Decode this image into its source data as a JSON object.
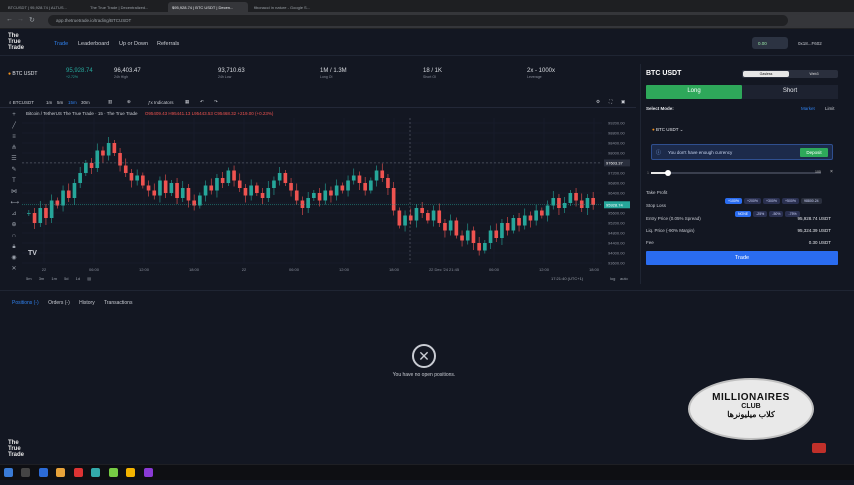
{
  "browser": {
    "tabs": [
      "BTCUSDT | 95,928.74 | ALTUS...",
      "The True Trade | Decentralized...",
      "$95,928.74 | BTC USDT | Decen...",
      "fibonacci in nature - Google S..."
    ],
    "url": "app.thetruetrade.io/trading/BTCUSDT"
  },
  "app": {
    "logo_line1": "The",
    "logo_line2": "True",
    "logo_line3": "Trade",
    "nav": [
      "Trade",
      "Leaderboard",
      "Up or Down",
      "Referrals"
    ],
    "balance": "0.00",
    "account": "0x18...F602"
  },
  "ticker": {
    "pair": "BTC USDT",
    "price": "95,928.74",
    "change": "+2.72%",
    "high_val": "96,403.47",
    "high_lbl": "24h High",
    "low_val": "93,710.63",
    "low_lbl": "24h Low",
    "long_oi_val": "1M / 1.3M",
    "long_oi_lbl": "Long OI",
    "short_oi_val": "18 / 1K",
    "short_oi_lbl": "Short OI",
    "lev_val": "2x - 1000x",
    "lev_lbl": "Leverage"
  },
  "toolbar": {
    "symbol": "BTCUSDT",
    "intervals": [
      "1m",
      "5m",
      "15m",
      "30m"
    ],
    "indicators": "Indicators"
  },
  "chart_data": {
    "type": "candlestick",
    "title": "Bitcoin / TetherUS  The True Trade · 15 · The True Trade",
    "ohlc_label": "O95409.43 H95441.13 L95443.53 C95468.32 +219.00 (+0.23%)",
    "ylim": [
      93600,
      99400
    ],
    "y_ticks": [
      "99200.00",
      "98800.00",
      "98400.00",
      "98000.00",
      "97600.00",
      "97200.00",
      "96800.00",
      "96400.00",
      "96000.00",
      "95600.00",
      "95200.00",
      "94800.00",
      "94400.00",
      "94000.00",
      "93600.00"
    ],
    "x_ticks": [
      "22",
      "06:00",
      "12:00",
      "18:00",
      "22",
      "06:00",
      "12:00",
      "18:00",
      "22 Dec '24  21:45",
      "06:00",
      "12:00",
      "18:00"
    ],
    "last_price_label": "95928.74",
    "crosshair_price_label": "97603.37",
    "close_series": [
      95600,
      95200,
      95800,
      95400,
      96100,
      95900,
      96500,
      96200,
      96800,
      97200,
      97600,
      97400,
      98100,
      97900,
      98400,
      98000,
      97500,
      97200,
      96900,
      97100,
      96700,
      96500,
      96300,
      96900,
      96400,
      96800,
      96200,
      96600,
      96100,
      95900,
      96300,
      96700,
      96500,
      97000,
      96800,
      97300,
      96900,
      96600,
      96300,
      96700,
      96400,
      96200,
      96600,
      96900,
      97200,
      96800,
      96500,
      96100,
      95800,
      96200,
      96400,
      96100,
      96500,
      96300,
      96700,
      96500,
      96900,
      97100,
      96800,
      96500,
      96900,
      97300,
      97000,
      96600,
      95700,
      95100,
      95500,
      95300,
      95800,
      95600,
      95300,
      95700,
      95200,
      94900,
      95300,
      94700,
      94500,
      94900,
      94400,
      94100,
      94400,
      94900,
      94600,
      95200,
      94900,
      95400,
      95100,
      95500,
      95300,
      95700,
      95500,
      95900,
      96200,
      95800,
      96000,
      96400,
      96100,
      95800,
      96200,
      95928
    ],
    "timezone": "17:21:40 (UTC+1)",
    "log_lbl": "log",
    "auto_lbl": "auto",
    "ranges": [
      "5m",
      "3m",
      "1m",
      "5d",
      "1d"
    ]
  },
  "panel": {
    "title": "BTC USDT",
    "toggle_a": "Gasless",
    "toggle_b": "Web3",
    "long": "Long",
    "short": "Short",
    "select_mode": "Select Mode:",
    "mode_market": "Market",
    "mode_limit": "Limit",
    "asset": "BTC USDT",
    "warning": "You don't have enough currency",
    "deposit": "Deposit",
    "slider_min": "1",
    "slider_max": "100",
    "tp_label": "Take Profit",
    "tp_chips": [
      "+100%",
      "+200%",
      "+300%",
      "+500%"
    ],
    "tp_val": "98800.24",
    "sl_label": "Stop Loss",
    "sl_chips": [
      "NONE",
      "-25%",
      "-50%",
      "-75%"
    ],
    "entry_label": "Entry Price (0.05% Spread)",
    "entry_val": "95,928.74 USDT",
    "liq_label": "Liq. Price (-90% Margin)",
    "liq_val": "95,324.39 USDT",
    "fee_label": "Fee",
    "fee_val": "0.30 USDT",
    "trade": "Trade"
  },
  "positions": {
    "tabs": [
      "Positions (-)",
      "Orders (-)",
      "History",
      "Transactions"
    ],
    "empty": "You have no open positions."
  },
  "badge": {
    "line1": "MILLIONAIRES",
    "line2": "CLUB",
    "line3": "کلاب میلیونرها"
  },
  "colors": {
    "up": "#26a69a",
    "down": "#ef5350",
    "accent": "#2f80ed",
    "long": "#2ea85a",
    "trade": "#2a6cf0"
  }
}
